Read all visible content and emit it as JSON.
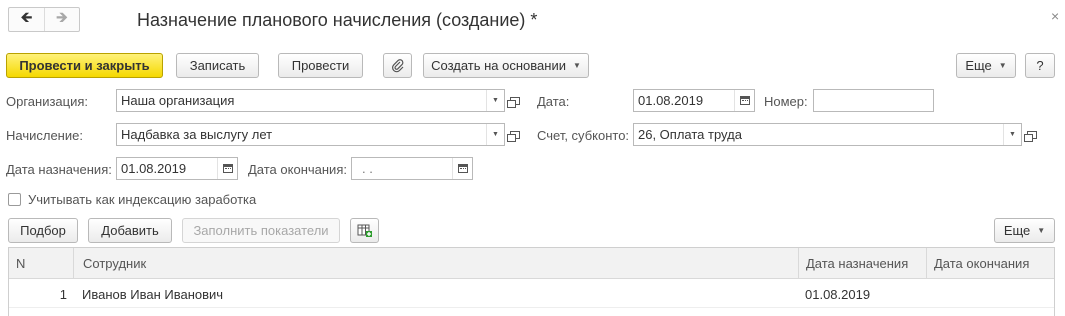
{
  "window": {
    "title": "Назначение планового начисления (создание) *",
    "back_icon": "arrow-left-icon",
    "forward_icon": "arrow-right-icon",
    "close_glyph": "×"
  },
  "toolbar": {
    "post_close": "Провести и закрыть",
    "save": "Записать",
    "post": "Провести",
    "attach_icon": "paperclip-icon",
    "create_based": "Создать на основании",
    "more": "Еще",
    "help": "?"
  },
  "form": {
    "org_label": "Организация:",
    "org_value": "Наша организация",
    "date_label": "Дата:",
    "date_value": "01.08.2019",
    "number_label": "Номер:",
    "number_value": "",
    "accrual_label": "Начисление:",
    "accrual_value": "Надбавка за выслугу лет",
    "account_label": "Счет, субконто:",
    "account_value": "26, Оплата труда",
    "assign_date_label": "Дата назначения:",
    "assign_date_value": "01.08.2019",
    "end_date_label": "Дата окончания:",
    "end_date_value": " .  .",
    "indexation_label": "Учитывать как индексацию заработка",
    "indexation_checked": false
  },
  "table_toolbar": {
    "select": "Подбор",
    "add": "Добавить",
    "fill": "Заполнить показатели",
    "grid_icon": "table-add-icon",
    "more": "Еще"
  },
  "table": {
    "columns": [
      "N",
      "Сотрудник",
      "Дата назначения",
      "Дата окончания"
    ],
    "rows": [
      {
        "n": "1",
        "employee": "Иванов Иван Иванович",
        "assign_date": "01.08.2019",
        "end_date": ""
      }
    ]
  },
  "colors": {
    "primary_button": "#f5d800",
    "border": "#b9b9b9",
    "header_bg": "#f2f2f2"
  }
}
